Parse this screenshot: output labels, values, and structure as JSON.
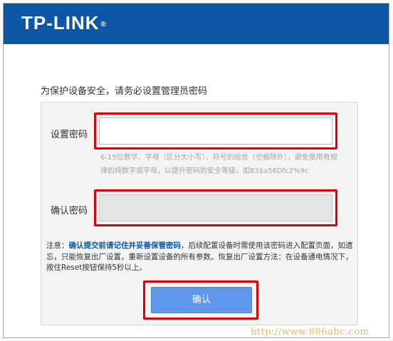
{
  "header": {
    "logo": "TP-LINK",
    "logo_mark": "®",
    "background_color": "#0b57a6"
  },
  "form": {
    "prompt": "为保护设备安全，请务必设置管理员密码",
    "password_label": "设置密码",
    "password_value": "",
    "password_hint": "6-15位数字、字母（区分大小写）、符号的组合（空格除外），避免使用有规律的纯数字或字母，以提升密码的安全等级，如83$a56Dfc2%9c",
    "confirm_label": "确认密码",
    "confirm_value": "",
    "note_prefix": "注意：",
    "note_emphasis": "确认提交前请记住并妥善保管密码",
    "note_rest": "，后续配置设备时需使用该密码进入配置页面，如遗忘，只能恢复出厂设置，重新设置设备的所有参数。恢复出厂设置方法：在设备通电情况下，按住Reset按钮保持5秒以上。",
    "submit_label": "确认",
    "highlight_color": "#e00000",
    "button_color": "#5f97ea"
  },
  "watermark": "http://www.886abc.com"
}
